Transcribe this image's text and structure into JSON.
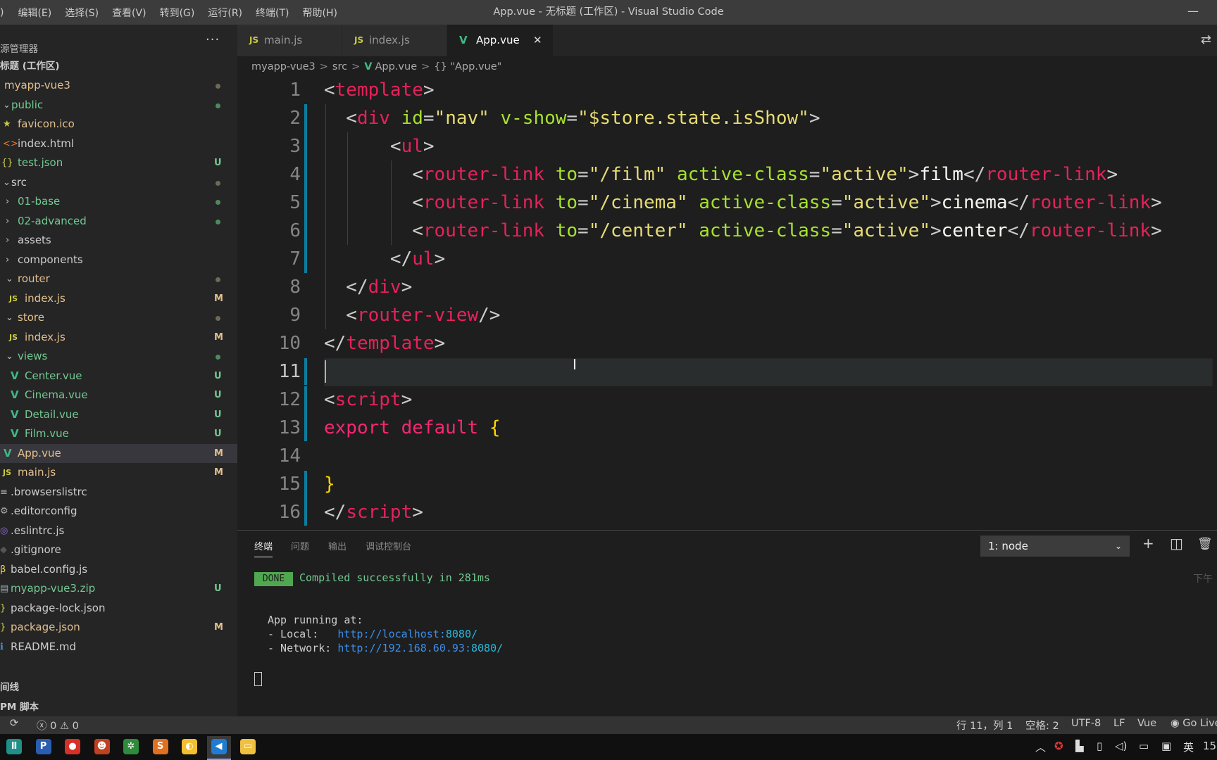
{
  "menu": {
    "items": [
      ")",
      "编辑(E)",
      "选择(S)",
      "查看(V)",
      "转到(G)",
      "运行(R)",
      "终端(T)",
      "帮助(H)"
    ],
    "window_title": "App.vue - 无标题 (工作区) - Visual Studio Code",
    "minimize": "—"
  },
  "sidebar": {
    "title": "源管理器",
    "more": "···",
    "workspace_title": "标题 (工作区)",
    "items": [
      {
        "label": "myapp-vue3",
        "icon": "",
        "badge": "dot"
      },
      {
        "label": "public",
        "icon": "⌄",
        "badge": "dot"
      },
      {
        "label": "favicon.ico",
        "icon": "★",
        "badge": ""
      },
      {
        "label": "index.html",
        "icon": "<>",
        "badge": ""
      },
      {
        "label": "test.json",
        "icon": "{}",
        "badge": "U"
      },
      {
        "label": "src",
        "icon": "⌄",
        "badge": "dot"
      },
      {
        "label": "01-base",
        "icon": "›",
        "badge": "dot"
      },
      {
        "label": "02-advanced",
        "icon": "›",
        "badge": "dot"
      },
      {
        "label": "assets",
        "icon": "›",
        "badge": ""
      },
      {
        "label": "components",
        "icon": "›",
        "badge": ""
      },
      {
        "label": "router",
        "icon": "⌄",
        "badge": "dot"
      },
      {
        "label": "index.js",
        "icon": "JS",
        "badge": "M"
      },
      {
        "label": "store",
        "icon": "⌄",
        "badge": "dot"
      },
      {
        "label": "index.js",
        "icon": "JS",
        "badge": "M"
      },
      {
        "label": "views",
        "icon": "⌄",
        "badge": "dot"
      },
      {
        "label": "Center.vue",
        "icon": "V",
        "badge": "U"
      },
      {
        "label": "Cinema.vue",
        "icon": "V",
        "badge": "U"
      },
      {
        "label": "Detail.vue",
        "icon": "V",
        "badge": "U"
      },
      {
        "label": "Film.vue",
        "icon": "V",
        "badge": "U"
      },
      {
        "label": "App.vue",
        "icon": "V",
        "badge": "M"
      },
      {
        "label": "main.js",
        "icon": "JS",
        "badge": "M"
      },
      {
        "label": ".browserslistrc",
        "icon": "≡",
        "badge": ""
      },
      {
        "label": ".editorconfig",
        "icon": "⚙",
        "badge": ""
      },
      {
        "label": ".eslintrc.js",
        "icon": "◎",
        "badge": ""
      },
      {
        "label": ".gitignore",
        "icon": "◆",
        "badge": ""
      },
      {
        "label": "babel.config.js",
        "icon": "β",
        "badge": ""
      },
      {
        "label": "myapp-vue3.zip",
        "icon": "▤",
        "badge": "U"
      },
      {
        "label": "package-lock.json",
        "icon": "}",
        "badge": ""
      },
      {
        "label": "package.json",
        "icon": "}",
        "badge": "M"
      },
      {
        "label": "README.md",
        "icon": "ℹ",
        "badge": ""
      }
    ],
    "section_outline": "间线",
    "section_npm": "PM 脚本"
  },
  "tabs": [
    {
      "label": "main.js",
      "icon": "JS"
    },
    {
      "label": "index.js",
      "icon": "JS"
    },
    {
      "label": "App.vue",
      "icon": "V",
      "close": "✕"
    }
  ],
  "breadcrumb": {
    "parts": [
      "myapp-vue3",
      "src",
      "App.vue",
      "{} \"App.vue\""
    ],
    "sep": ">"
  },
  "editor": {
    "line_numbers": [
      "1",
      "2",
      "3",
      "4",
      "5",
      "6",
      "7",
      "8",
      "9",
      "10",
      "11",
      "12",
      "13",
      "14",
      "15",
      "16"
    ],
    "lines": [
      [
        [
          "b",
          "<"
        ],
        [
          "t",
          "template"
        ],
        [
          "b",
          ">"
        ]
      ],
      [
        [
          "b",
          "  <"
        ],
        [
          "t",
          "div"
        ],
        [
          "x",
          " "
        ],
        [
          "a",
          "id"
        ],
        [
          "b",
          "="
        ],
        [
          "s",
          "\"nav\""
        ],
        [
          "x",
          " "
        ],
        [
          "a",
          "v-show"
        ],
        [
          "b",
          "="
        ],
        [
          "s",
          "\"$store.state.isShow\""
        ],
        [
          "b",
          ">"
        ]
      ],
      [
        [
          "b",
          "      <"
        ],
        [
          "t",
          "ul"
        ],
        [
          "b",
          ">"
        ]
      ],
      [
        [
          "b",
          "        <"
        ],
        [
          "t",
          "router-link"
        ],
        [
          "x",
          " "
        ],
        [
          "a",
          "to"
        ],
        [
          "b",
          "="
        ],
        [
          "s",
          "\"/film\""
        ],
        [
          "x",
          " "
        ],
        [
          "a",
          "active-class"
        ],
        [
          "b",
          "="
        ],
        [
          "s",
          "\"active\""
        ],
        [
          "b",
          ">"
        ],
        [
          "x",
          "film"
        ],
        [
          "b",
          "</"
        ],
        [
          "t",
          "router-link"
        ],
        [
          "b",
          ">"
        ]
      ],
      [
        [
          "b",
          "        <"
        ],
        [
          "t",
          "router-link"
        ],
        [
          "x",
          " "
        ],
        [
          "a",
          "to"
        ],
        [
          "b",
          "="
        ],
        [
          "s",
          "\"/cinema\""
        ],
        [
          "x",
          " "
        ],
        [
          "a",
          "active-class"
        ],
        [
          "b",
          "="
        ],
        [
          "s",
          "\"active\""
        ],
        [
          "b",
          ">"
        ],
        [
          "x",
          "cinema"
        ],
        [
          "b",
          "</"
        ],
        [
          "t",
          "router-link"
        ],
        [
          "b",
          ">"
        ]
      ],
      [
        [
          "b",
          "        <"
        ],
        [
          "t",
          "router-link"
        ],
        [
          "x",
          " "
        ],
        [
          "a",
          "to"
        ],
        [
          "b",
          "="
        ],
        [
          "s",
          "\"/center\""
        ],
        [
          "x",
          " "
        ],
        [
          "a",
          "active-class"
        ],
        [
          "b",
          "="
        ],
        [
          "s",
          "\"active\""
        ],
        [
          "b",
          ">"
        ],
        [
          "x",
          "center"
        ],
        [
          "b",
          "</"
        ],
        [
          "t",
          "router-link"
        ],
        [
          "b",
          ">"
        ]
      ],
      [
        [
          "b",
          "      </"
        ],
        [
          "t",
          "ul"
        ],
        [
          "b",
          ">"
        ]
      ],
      [
        [
          "b",
          "  </"
        ],
        [
          "t",
          "div"
        ],
        [
          "b",
          ">"
        ]
      ],
      [
        [
          "b",
          "  <"
        ],
        [
          "t",
          "router-view"
        ],
        [
          "b",
          "/>"
        ]
      ],
      [
        [
          "b",
          "</"
        ],
        [
          "t",
          "template"
        ],
        [
          "b",
          ">"
        ]
      ],
      [],
      [
        [
          "b",
          "<"
        ],
        [
          "t",
          "script"
        ],
        [
          "b",
          ">"
        ]
      ],
      [
        [
          "k",
          "export default "
        ],
        [
          "y",
          "{"
        ]
      ],
      [],
      [
        [
          "y",
          "}"
        ]
      ],
      [
        [
          "b",
          "</"
        ],
        [
          "t",
          "script"
        ],
        [
          "b",
          ">"
        ]
      ]
    ]
  },
  "panel": {
    "tabs": [
      "终端",
      "问题",
      "输出",
      "调试控制台"
    ],
    "terminal_select": "1: node",
    "add": "+",
    "split": "◫",
    "trash": "🗑",
    "done_badge": "DONE",
    "compiled": "Compiled successfully in 281ms",
    "running": "App running at:",
    "local_label": "- Local:   ",
    "local_url": "http://localhost:",
    "local_port": "8080/",
    "network_label": "- Network: ",
    "network_url": "http://192.168.60.93:",
    "network_port": "8080/",
    "clock_fragment": "下午"
  },
  "statusbar": {
    "errors": "0",
    "warnings": "0",
    "position": "行 11，列 1",
    "spaces": "空格: 2",
    "encoding": "UTF-8",
    "eol": "LF",
    "language": "Vue",
    "golive": "Go Live"
  },
  "taskbar": {
    "apps": [
      {
        "name": "app-1",
        "color": "#1f8f87",
        "glyph": "Ⅱ"
      },
      {
        "name": "app-2",
        "color": "#2a5db0",
        "glyph": "P"
      },
      {
        "name": "chrome",
        "color": "#d93025",
        "glyph": "●"
      },
      {
        "name": "app-4",
        "color": "#c04020",
        "glyph": "☻"
      },
      {
        "name": "app-5",
        "color": "#2e8b3a",
        "glyph": "✲"
      },
      {
        "name": "sublime",
        "color": "#e07020",
        "glyph": "S"
      },
      {
        "name": "app-7",
        "color": "#f0c030",
        "glyph": "◐"
      },
      {
        "name": "vscode",
        "color": "#1f7cd0",
        "glyph": "◀"
      },
      {
        "name": "explorer",
        "color": "#f0c040",
        "glyph": "▭"
      }
    ],
    "tray_ime": "英",
    "clock": "15"
  },
  "colors": {
    "accent": "#007acc",
    "modified": "#e2c08d",
    "untracked": "#73c991"
  }
}
